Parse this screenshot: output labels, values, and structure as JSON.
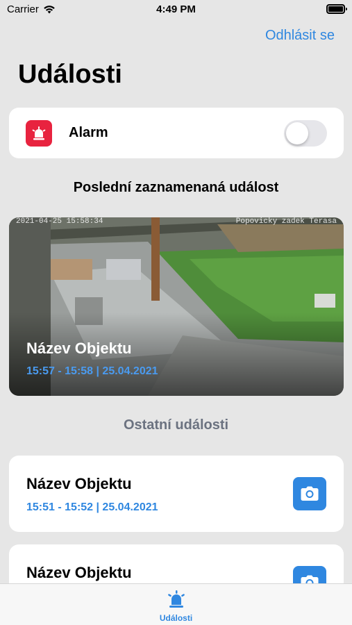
{
  "status_bar": {
    "carrier": "Carrier",
    "time": "4:49 PM"
  },
  "header": {
    "logout_label": "Odhlásit se",
    "title": "Události"
  },
  "alarm": {
    "label": "Alarm",
    "enabled": false,
    "icon": "siren-icon",
    "icon_color": "#e8233f"
  },
  "last_event": {
    "section_title": "Poslední zaznamenaná událost",
    "camera_stamp_left": "2021-04-25 15:58:34",
    "camera_stamp_right": "Popovicky zadek Terasa",
    "name": "Název Objektu",
    "time": "15:57 - 15:58 | 25.04.2021"
  },
  "other_events": {
    "section_title": "Ostatní události",
    "items": [
      {
        "name": "Název Objektu",
        "time": "15:51 - 15:52 | 25.04.2021"
      },
      {
        "name": "Název Objektu",
        "time": ""
      }
    ]
  },
  "tab_bar": {
    "active_tab": "Události",
    "icon": "siren-icon"
  },
  "colors": {
    "accent": "#2f87e0",
    "alarm": "#e8233f",
    "background": "#e6e6e6"
  }
}
